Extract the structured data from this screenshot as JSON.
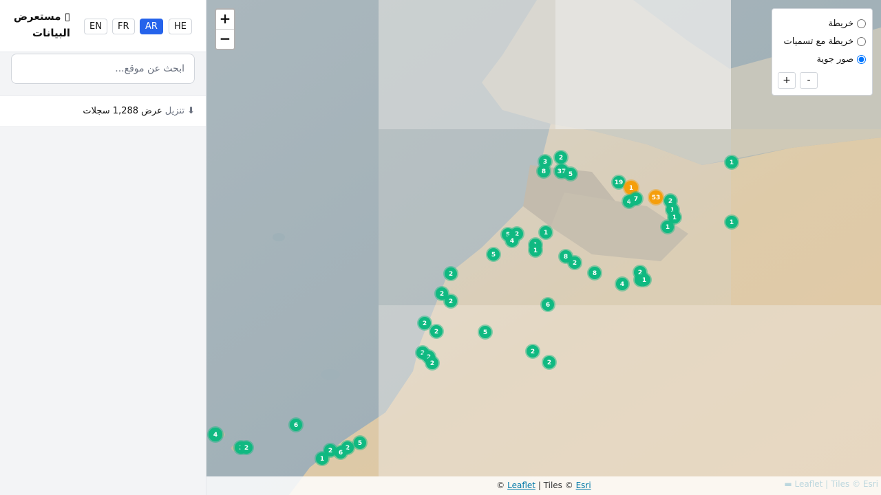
{
  "app": {
    "title": "مستعرض البيانات",
    "title_icon": "map-icon"
  },
  "languages": [
    {
      "code": "EN",
      "active": false
    },
    {
      "code": "FR",
      "active": false
    },
    {
      "code": "AR",
      "active": true
    },
    {
      "code": "HE",
      "active": false
    }
  ],
  "search": {
    "placeholder": "ابحث عن موقع..."
  },
  "stats": {
    "download_icon": "download-icon",
    "download_label": "⬇ تنزيل",
    "summary": "عرض 1,288 سجلات"
  },
  "map": {
    "zoom_in": "+",
    "zoom_out": "−",
    "layers": [
      {
        "label": "خريطة",
        "selected": false
      },
      {
        "label": "خريطة مع تسميات",
        "selected": false
      },
      {
        "label": "صور جوية",
        "selected": true
      }
    ],
    "panel_plus": "+",
    "panel_minus": "-",
    "attribution": {
      "prefix": "©",
      "leaflet": "Leaflet",
      "separator": "| Tiles ©",
      "esri": "Esri",
      "ghost": "▬ Leaflet | Tiles © Esri"
    },
    "colors": {
      "cluster": "#10b981",
      "cluster_large": "#f59e0b"
    }
  },
  "clusters": [
    {
      "count": "2"
    },
    {
      "count": "3"
    },
    {
      "count": "8"
    },
    {
      "count": "37"
    },
    {
      "count": "5"
    },
    {
      "count": "19"
    },
    {
      "count": "1"
    },
    {
      "count": "4"
    },
    {
      "count": "7"
    },
    {
      "count": "53"
    },
    {
      "count": "2"
    },
    {
      "count": "1"
    },
    {
      "count": "1"
    },
    {
      "count": "1"
    },
    {
      "count": "1"
    },
    {
      "count": "1"
    },
    {
      "count": "1"
    },
    {
      "count": "5"
    },
    {
      "count": "2"
    },
    {
      "count": "4"
    },
    {
      "count": "1"
    },
    {
      "count": "1"
    },
    {
      "count": "1"
    },
    {
      "count": "5"
    },
    {
      "count": "8"
    },
    {
      "count": "2"
    },
    {
      "count": "8"
    },
    {
      "count": "2"
    },
    {
      "count": "1"
    },
    {
      "count": "4"
    },
    {
      "count": "2"
    },
    {
      "count": "2"
    },
    {
      "count": "2"
    },
    {
      "count": "6"
    },
    {
      "count": "2"
    },
    {
      "count": "2"
    },
    {
      "count": "5"
    },
    {
      "count": "2"
    },
    {
      "count": "2"
    },
    {
      "count": "2"
    },
    {
      "count": "2"
    },
    {
      "count": "2"
    },
    {
      "count": "6"
    },
    {
      "count": "4"
    },
    {
      "count": "2"
    },
    {
      "count": "2"
    },
    {
      "count": "5"
    },
    {
      "count": "2"
    },
    {
      "count": "6"
    },
    {
      "count": "2"
    },
    {
      "count": "1"
    }
  ]
}
